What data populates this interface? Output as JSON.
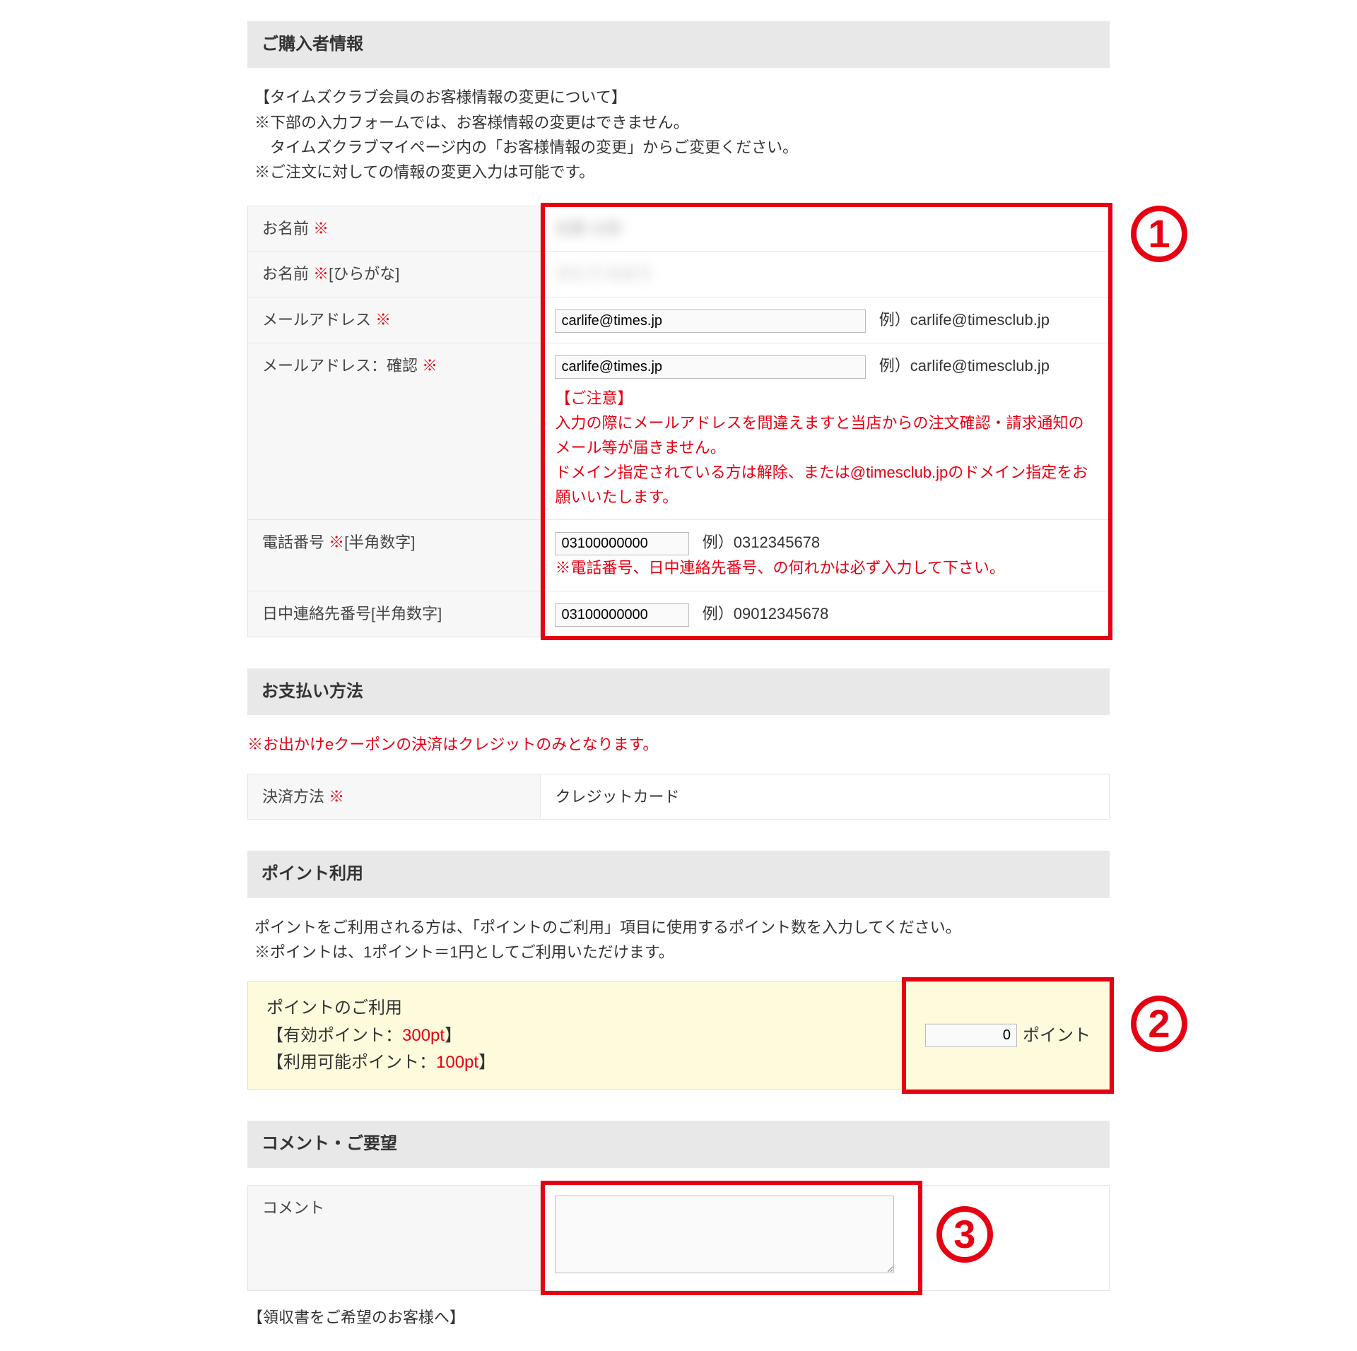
{
  "sections": {
    "buyer": {
      "title": "ご購入者情報",
      "notice_title": "【タイムズクラブ会員のお客様情報の変更について】",
      "notice_line1": "※下部の入力フォームでは、お客様情報の変更はできません。",
      "notice_line2": "　タイムズクラブマイページ内の「お客様情報の変更」からご変更ください。",
      "notice_line3": "※ご注文に対しての情報の変更入力は可能です。",
      "rows": {
        "name": {
          "label": "お名前 ",
          "req": "※",
          "value_blur": "佐藤 太郎"
        },
        "name_kana": {
          "label": "お名前 ",
          "req": "※",
          "suffix": "[ひらがな]",
          "value_blur": "さとう たろう"
        },
        "email": {
          "label": "メールアドレス ",
          "req": "※",
          "value": "carlife@times.jp",
          "example": "例）carlife@timesclub.jp"
        },
        "email_confirm": {
          "label": "メールアドレス：確認 ",
          "req": "※",
          "value": "carlife@times.jp",
          "example": "例）carlife@timesclub.jp",
          "warn_title": "【ご注意】",
          "warn1": "入力の際にメールアドレスを間違えますと当店からの注文確認・請求通知のメール等が届きません。",
          "warn2": "ドメイン指定されている方は解除、または@timesclub.jpのドメイン指定をお願いいたします。"
        },
        "phone": {
          "label": "電話番号 ",
          "req": "※",
          "suffix": "[半角数字]",
          "value": "03100000000",
          "example": "例）0312345678",
          "note": "※電話番号、日中連絡先番号、の何れかは必ず入力して下さい。"
        },
        "day_phone": {
          "label": "日中連絡先番号[半角数字]",
          "value": "03100000000",
          "example": "例）09012345678"
        }
      }
    },
    "payment": {
      "title": "お支払い方法",
      "note": "※お出かけeクーポンの決済はクレジットのみとなります。",
      "method_label": "決済方法 ",
      "method_req": "※",
      "method_value": "クレジットカード"
    },
    "points": {
      "title": "ポイント利用",
      "desc1": "ポイントをご利用される方は、「ポイントのご利用」項目に使用するポイント数を入力してください。",
      "desc2": "※ポイントは、1ポイント＝1円としてご利用いただけます。",
      "box": {
        "line1": "ポイントのご利用",
        "line2a": "【有効ポイント：",
        "line2b": "300pt",
        "line2c": "】",
        "line3a": "【利用可能ポイント：",
        "line3b": "100pt",
        "line3c": "】",
        "input_value": "0",
        "unit": "ポイント"
      }
    },
    "comment": {
      "title": "コメント・ご要望",
      "label": "コメント",
      "value": ""
    },
    "receipt_heading": "【領収書をご希望のお客様へ】"
  },
  "annotations": {
    "n1": "1",
    "n2": "2",
    "n3": "3"
  }
}
